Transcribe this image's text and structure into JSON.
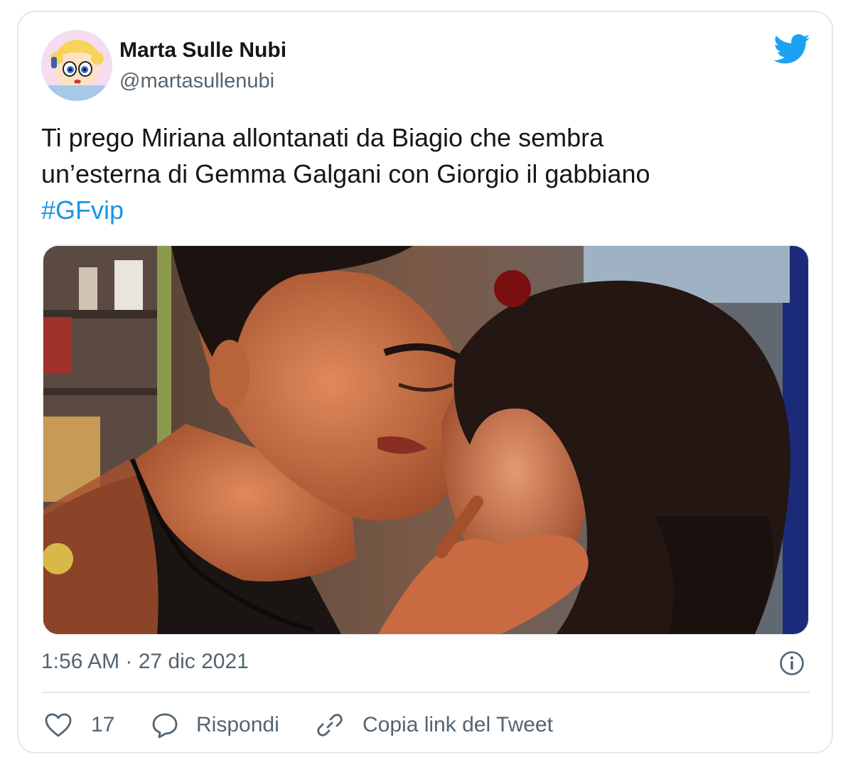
{
  "author": {
    "name": "Marta Sulle Nubi",
    "handle": "@martasullenubi"
  },
  "tweet": {
    "lines": [
      "Ti prego Miriana allontanati da Biagio che sembra",
      "un’esterna di Gemma Galgani con Giorgio il gabbiano"
    ],
    "hashtag": "#GFvip"
  },
  "timestamp": "1:56 AM · 27 dic 2021",
  "actions": {
    "like_count": "17",
    "reply_label": "Rispondi",
    "copy_link_label": "Copia link del Tweet"
  },
  "icons": {
    "brand": "twitter-bird-icon",
    "info": "info-icon",
    "like": "heart-icon",
    "reply": "speech-bubble-icon",
    "copy": "link-icon"
  },
  "colors": {
    "brand": "#1da1f2",
    "hashtag": "#1b95e0",
    "secondary_text": "#536471",
    "border": "#e1e8ed"
  }
}
